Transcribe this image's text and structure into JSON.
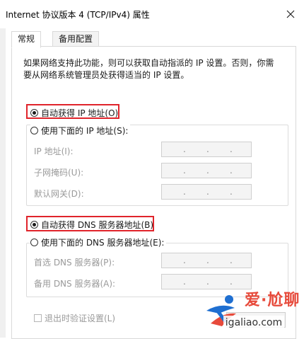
{
  "window": {
    "title": "Internet 协议版本 4 (TCP/IPv4) 属性",
    "close_glyph": "✕"
  },
  "tabs": [
    {
      "label": "常规",
      "active": true
    },
    {
      "label": "备用配置",
      "active": false
    }
  ],
  "description": "如果网络支持此功能，则可以获取自动指派的 IP 设置。否则，你需要从网络系统管理员处获得适当的 IP 设置。",
  "ip_section": {
    "auto_option": {
      "label": "自动获得 IP 地址(O)",
      "checked": true
    },
    "manual_option": {
      "label": "使用下面的 IP 地址(S):",
      "checked": false
    },
    "fields": [
      {
        "label": "IP 地址(I):",
        "value": ".      .      ."
      },
      {
        "label": "子网掩码(U):",
        "value": ".      .      ."
      },
      {
        "label": "默认网关(D):",
        "value": ".      .      ."
      }
    ]
  },
  "dns_section": {
    "auto_option": {
      "label": "自动获得 DNS 服务器地址(B)",
      "checked": true
    },
    "manual_option": {
      "label": "使用下面的 DNS 服务器地址(E):",
      "checked": false
    },
    "fields": [
      {
        "label": "首选 DNS 服务器(P):",
        "value": ".      .      ."
      },
      {
        "label": "备用 DNS 服务器(A):",
        "value": ".      .      ."
      }
    ]
  },
  "validate_on_exit": {
    "label": "退出时验证设置(L)",
    "checked": false
  },
  "watermark": {
    "brand_text": "爱·尬聊",
    "url": "igaliao.com"
  },
  "colors": {
    "highlight_border": "#e0242b",
    "watermark_red": "#e74a3b",
    "disabled_text": "#9a9a9a"
  }
}
